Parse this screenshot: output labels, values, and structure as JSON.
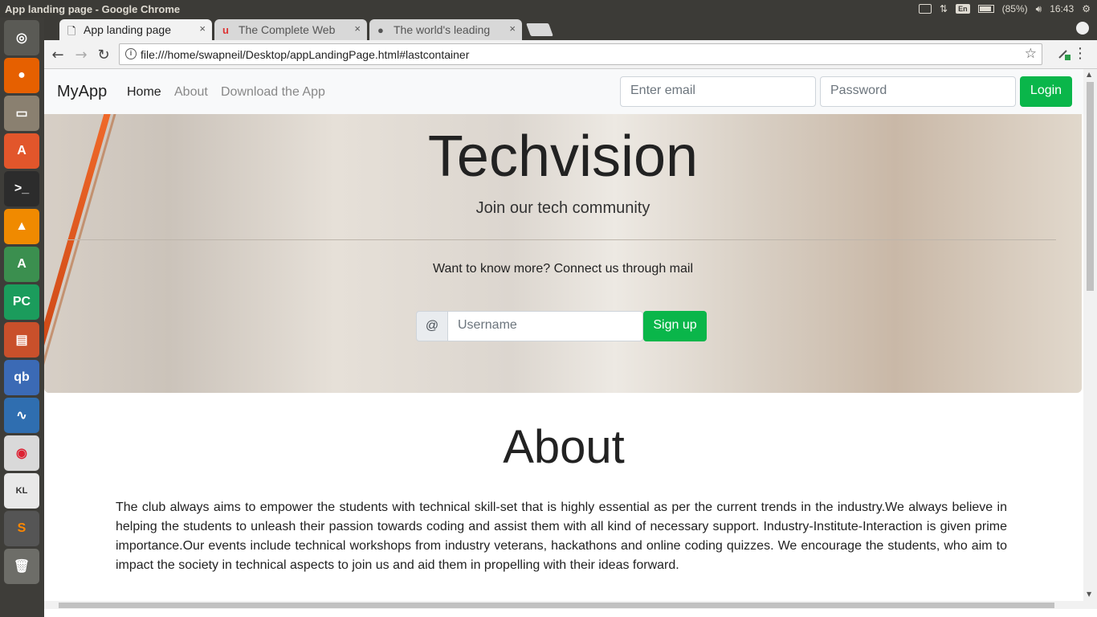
{
  "os": {
    "window_title": "App landing page - Google Chrome",
    "keyboard_layout": "En",
    "battery": "(85%)",
    "clock": "16:43",
    "launcher_apps": [
      "ubuntu-dash",
      "firefox",
      "files",
      "software-center",
      "terminal",
      "vlc",
      "android-studio",
      "pycharm",
      "impress",
      "qbittorrent",
      "system-monitor",
      "chrome",
      "keyboard",
      "sublime-text",
      "trash"
    ]
  },
  "browser": {
    "tabs": [
      {
        "label": "App landing page",
        "active": true
      },
      {
        "label": "The Complete Web",
        "active": false
      },
      {
        "label": "The world's leading",
        "active": false
      }
    ],
    "close_glyph": "×",
    "url": "file:///home/swapneil/Desktop/appLandingPage.html#lastcontainer"
  },
  "page": {
    "navbar": {
      "brand": "MyApp",
      "links": [
        "Home",
        "About",
        "Download the App"
      ],
      "email_placeholder": "Enter email",
      "password_placeholder": "Password",
      "login_label": "Login"
    },
    "hero": {
      "title": "Techvision",
      "subtitle": "Join our tech community",
      "prompt": "Want to know more? Connect us through mail",
      "at_symbol": "@",
      "username_placeholder": "Username",
      "signup_label": "Sign up"
    },
    "about": {
      "heading": "About",
      "body": "The club always aims to empower the students with technical skill-set that is highly essential as per the current trends in the industry.We always believe in helping the students to unleash their passion towards coding and assist them with all kind of necessary support. Industry-Institute-Interaction is given prime importance.Our events include technical workshops from industry veterans, hackathons and online coding quizzes. We encourage the students, who aim to impact the society in technical aspects to join us and aid them in propelling with their ideas forward."
    },
    "colors": {
      "accent_green": "#0ab64a",
      "navbar_bg": "#f8f9fa"
    }
  }
}
